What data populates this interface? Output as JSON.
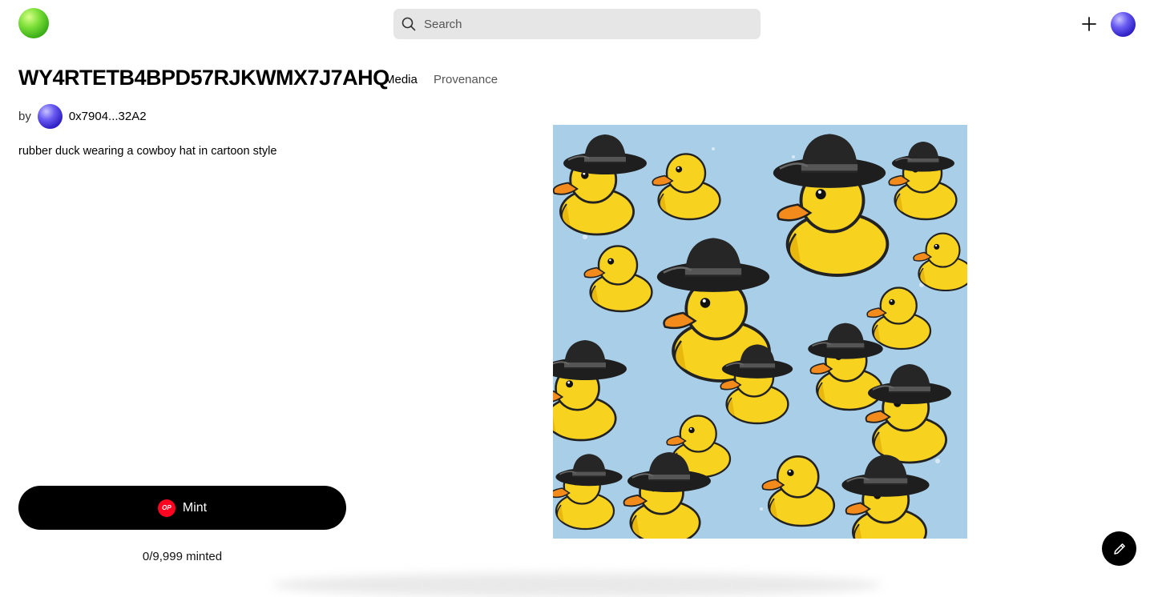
{
  "header": {
    "search_placeholder": "Search"
  },
  "token": {
    "title": "WY4RTETB4BPD57RJKWMX7J7AHQ",
    "by_label": "by",
    "creator_address": "0x7904...32A2",
    "description": "rubber duck wearing a cowboy hat in cartoon style"
  },
  "tabs": [
    {
      "label": "Media",
      "active": true
    },
    {
      "label": "Provenance",
      "active": false
    }
  ],
  "mint": {
    "badge_text": "OP",
    "label": "Mint",
    "minted_status": "0/9,999 minted"
  },
  "icons": {
    "logo": "green-orb-logo",
    "search": "search-icon",
    "create": "plus-icon",
    "edit": "pencil-icon"
  },
  "colors": {
    "mint_button": "#000000",
    "op_badge": "#ff0420",
    "search_bg": "#e6e6e6",
    "artwork_bg": "#a9cfe8"
  }
}
